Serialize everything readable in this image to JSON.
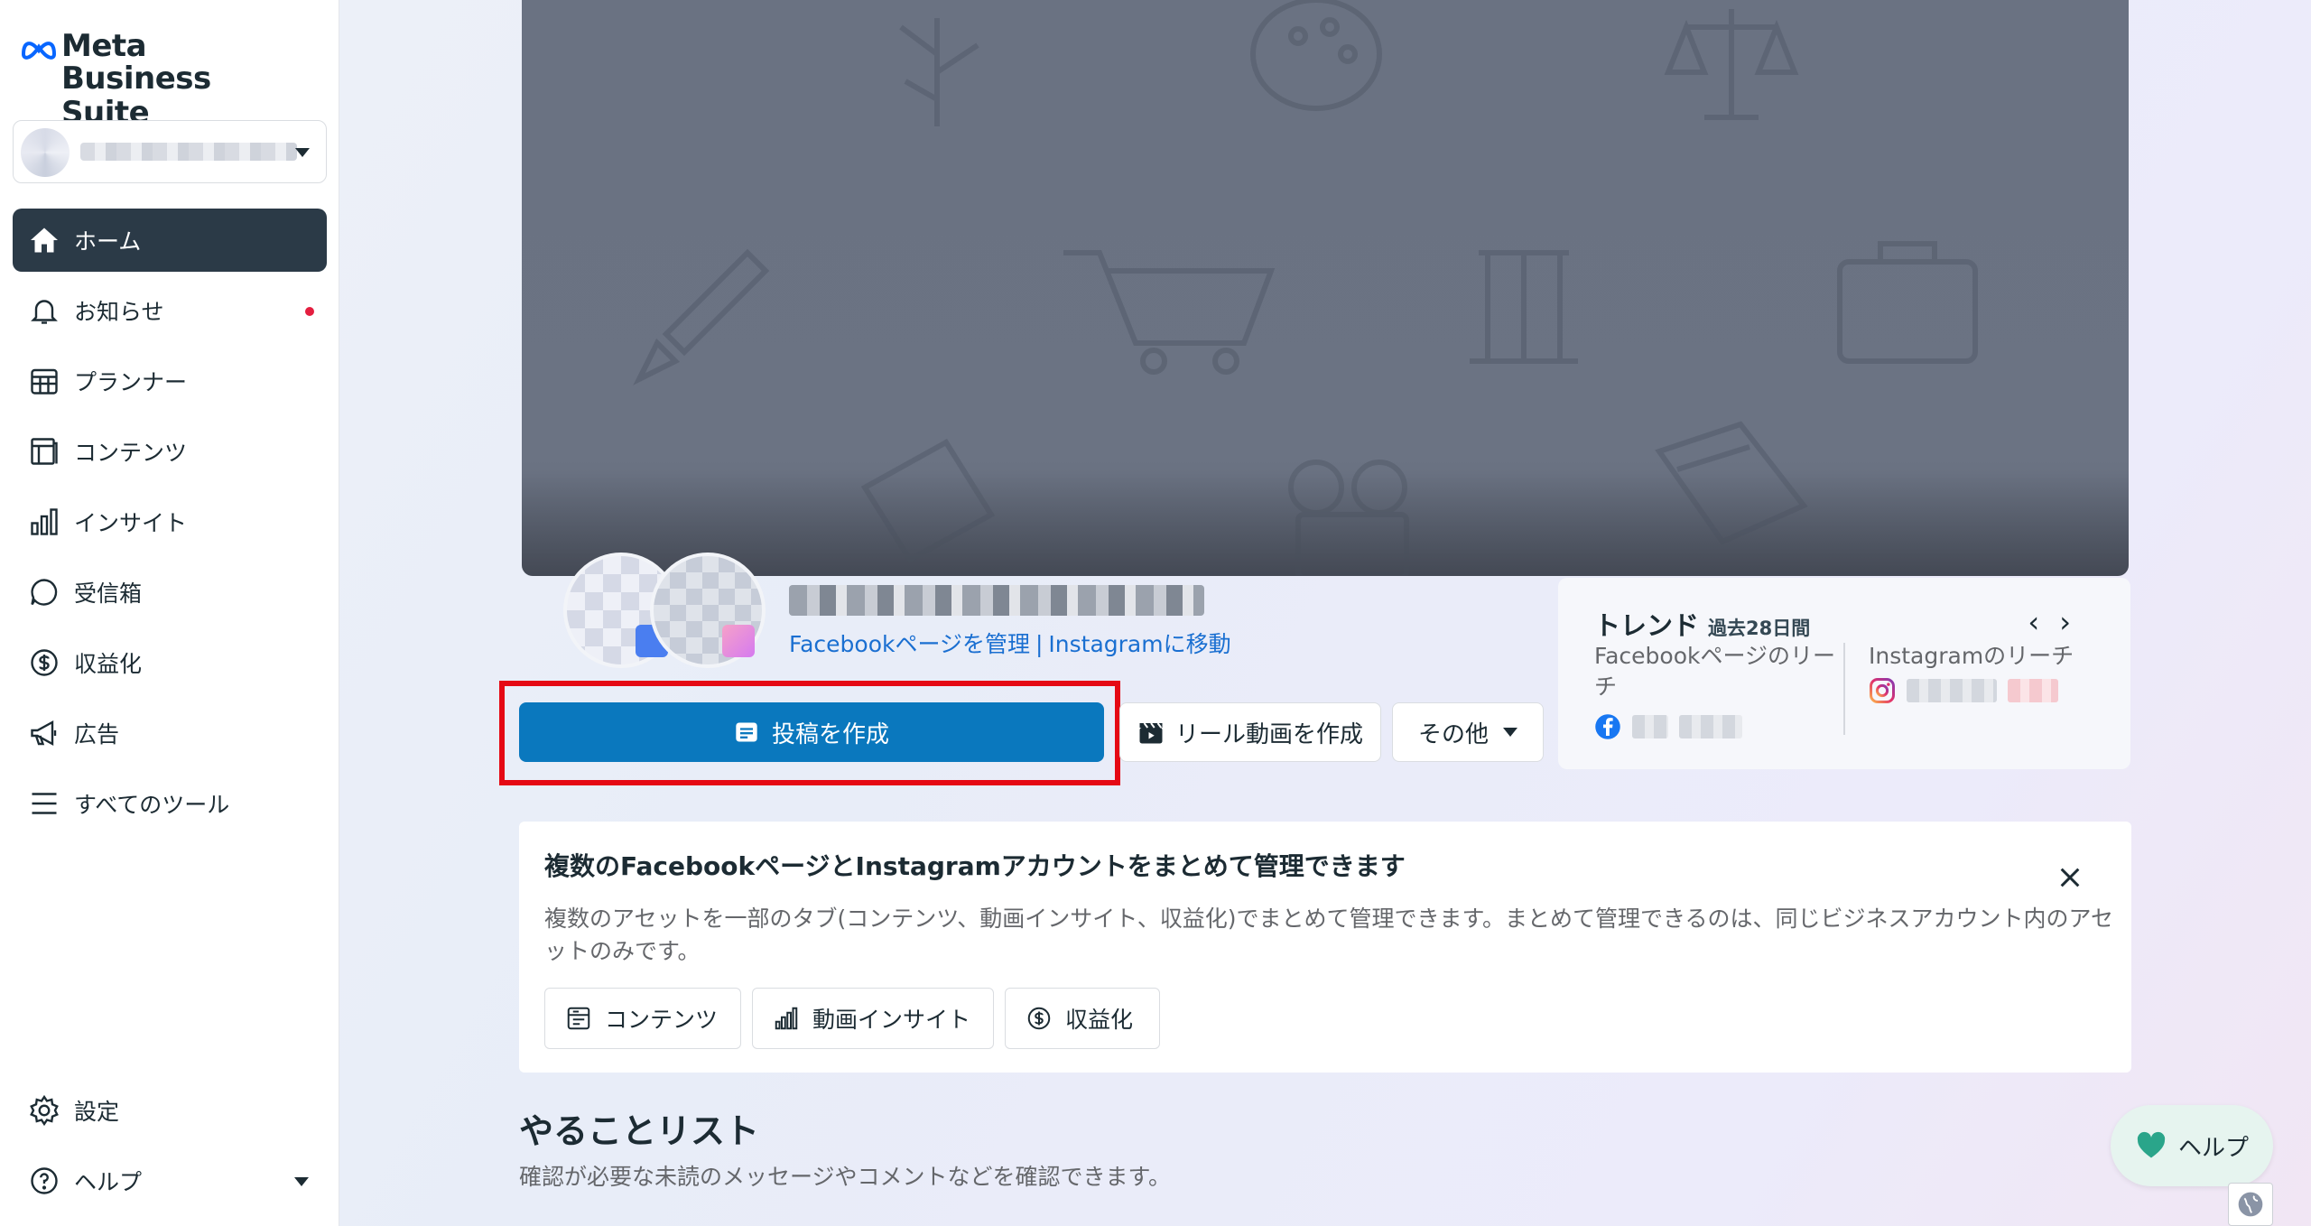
{
  "brand": {
    "line1": "Meta",
    "line2": "Business Suite"
  },
  "sidebar": {
    "items": [
      {
        "label": "ホーム",
        "icon": "home-icon",
        "active": true
      },
      {
        "label": "お知らせ",
        "icon": "bell-icon",
        "has_dot": true
      },
      {
        "label": "プランナー",
        "icon": "calendar-grid-icon"
      },
      {
        "label": "コンテンツ",
        "icon": "content-icon"
      },
      {
        "label": "インサイト",
        "icon": "bar-chart-icon"
      },
      {
        "label": "受信箱",
        "icon": "chat-bubble-icon"
      },
      {
        "label": "収益化",
        "icon": "dollar-circle-icon"
      },
      {
        "label": "広告",
        "icon": "megaphone-icon"
      },
      {
        "label": "すべてのツール",
        "icon": "menu-icon"
      }
    ],
    "bottom": [
      {
        "label": "設定",
        "icon": "gear-icon"
      },
      {
        "label": "ヘルプ",
        "icon": "question-circle-icon"
      }
    ]
  },
  "profile": {
    "manage_facebook": "Facebookページを管理",
    "separator": "|",
    "move_instagram": "Instagramに移動"
  },
  "actions": {
    "create_post": "投稿を作成",
    "create_reel": "リール動画を作成",
    "more": "その他"
  },
  "trend": {
    "title": "トレンド",
    "period": "過去28日間",
    "facebook_reach": "Facebookページのリーチ",
    "instagram_reach": "Instagramのリーチ"
  },
  "notice_card": {
    "title": "複数のFacebookページとInstagramアカウントをまとめて管理できます",
    "description": "複数のアセットを一部のタブ(コンテンツ、動画インサイト、収益化)でまとめて管理できます。まとめて管理できるのは、同じビジネスアカウント内のアセットのみです。",
    "chips": [
      "コンテンツ",
      "動画インサイト",
      "収益化"
    ]
  },
  "todo": {
    "title": "やることリスト",
    "description": "確認が必要な未読のメッセージやコメントなどを確認できます。"
  },
  "help_button": "ヘルプ",
  "colors": {
    "primary": "#0a78be",
    "sidebar_active": "#2b3a47",
    "highlight": "#e50914",
    "notification_dot": "#e41e3f",
    "link": "#1a6fd1"
  }
}
